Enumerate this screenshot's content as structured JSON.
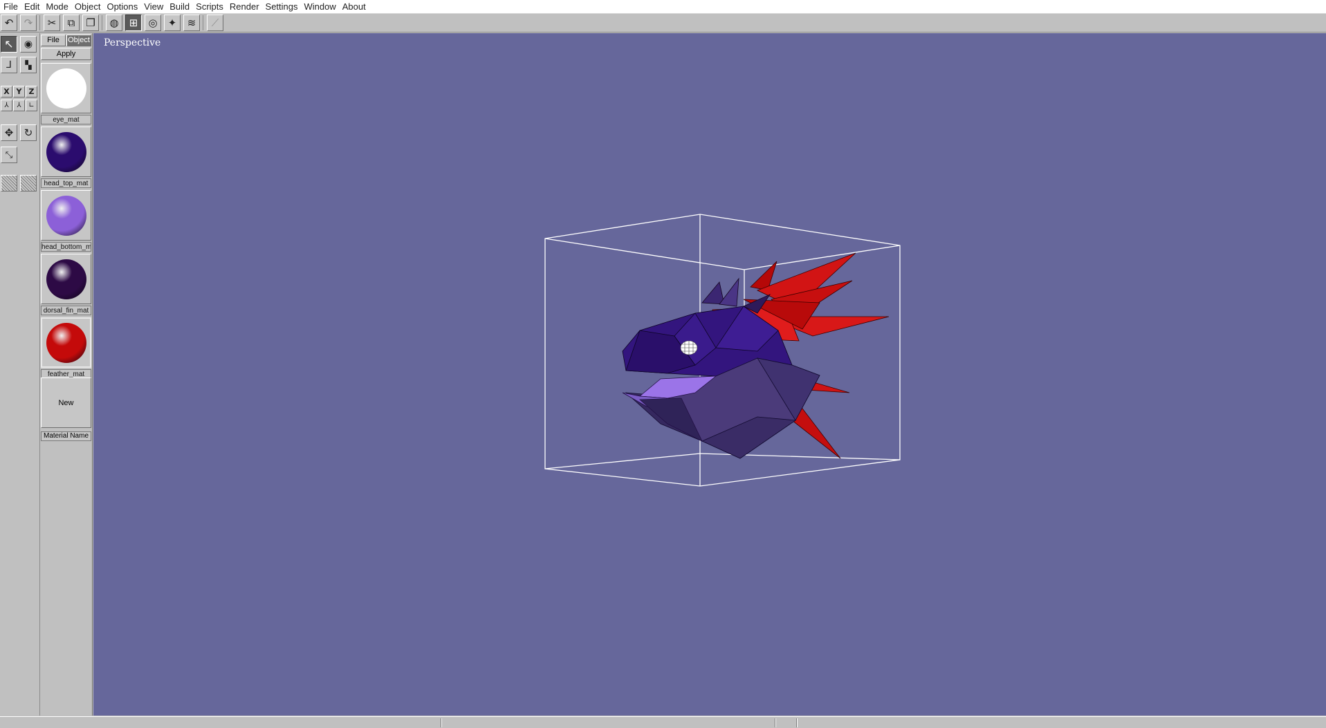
{
  "menu": [
    "File",
    "Edit",
    "Mode",
    "Object",
    "Options",
    "View",
    "Build",
    "Scripts",
    "Render",
    "Settings",
    "Window",
    "About"
  ],
  "toolbar": {
    "buttons": [
      {
        "icon": "undo-icon",
        "glyph": "↶"
      },
      {
        "icon": "redo-icon",
        "glyph": "↷"
      },
      {
        "icon": "cut-icon",
        "glyph": "✂"
      },
      {
        "icon": "copy-icon",
        "glyph": "⧉"
      },
      {
        "icon": "paste-icon",
        "glyph": "❐"
      },
      {
        "icon": "sphere-wire-icon",
        "glyph": "◍"
      },
      {
        "icon": "quad-view-icon",
        "glyph": "⊞"
      },
      {
        "icon": "orbit-icon",
        "glyph": "◎"
      },
      {
        "icon": "snap-icon",
        "glyph": "✦"
      },
      {
        "icon": "layers-icon",
        "glyph": "≋"
      },
      {
        "icon": "graph-icon",
        "glyph": "⟋"
      }
    ]
  },
  "tools": {
    "select": "↖",
    "visibility": "◉",
    "axes": "⅃",
    "points": "▚",
    "x_label": "X",
    "y_label": "Y",
    "z_label": "Z",
    "move": "✥",
    "rotate": "↻",
    "scale": "⤡"
  },
  "material_panel": {
    "tab_file": "File",
    "tab_object": "Object",
    "apply_label": "Apply",
    "materials": [
      {
        "name": "eye_mat",
        "color": "#ffffff"
      },
      {
        "name": "head_top_mat",
        "color": "#2b0c6e"
      },
      {
        "name": "head_bottom_mat",
        "color": "#8c60d8"
      },
      {
        "name": "dorsal_fin_mat",
        "color": "#2d0a45"
      },
      {
        "name": "feather_mat",
        "color": "#c40a0a"
      }
    ],
    "new_label": "New",
    "name_field": "Material Name"
  },
  "viewport": {
    "label": "Perspective",
    "background": "#66679b"
  }
}
